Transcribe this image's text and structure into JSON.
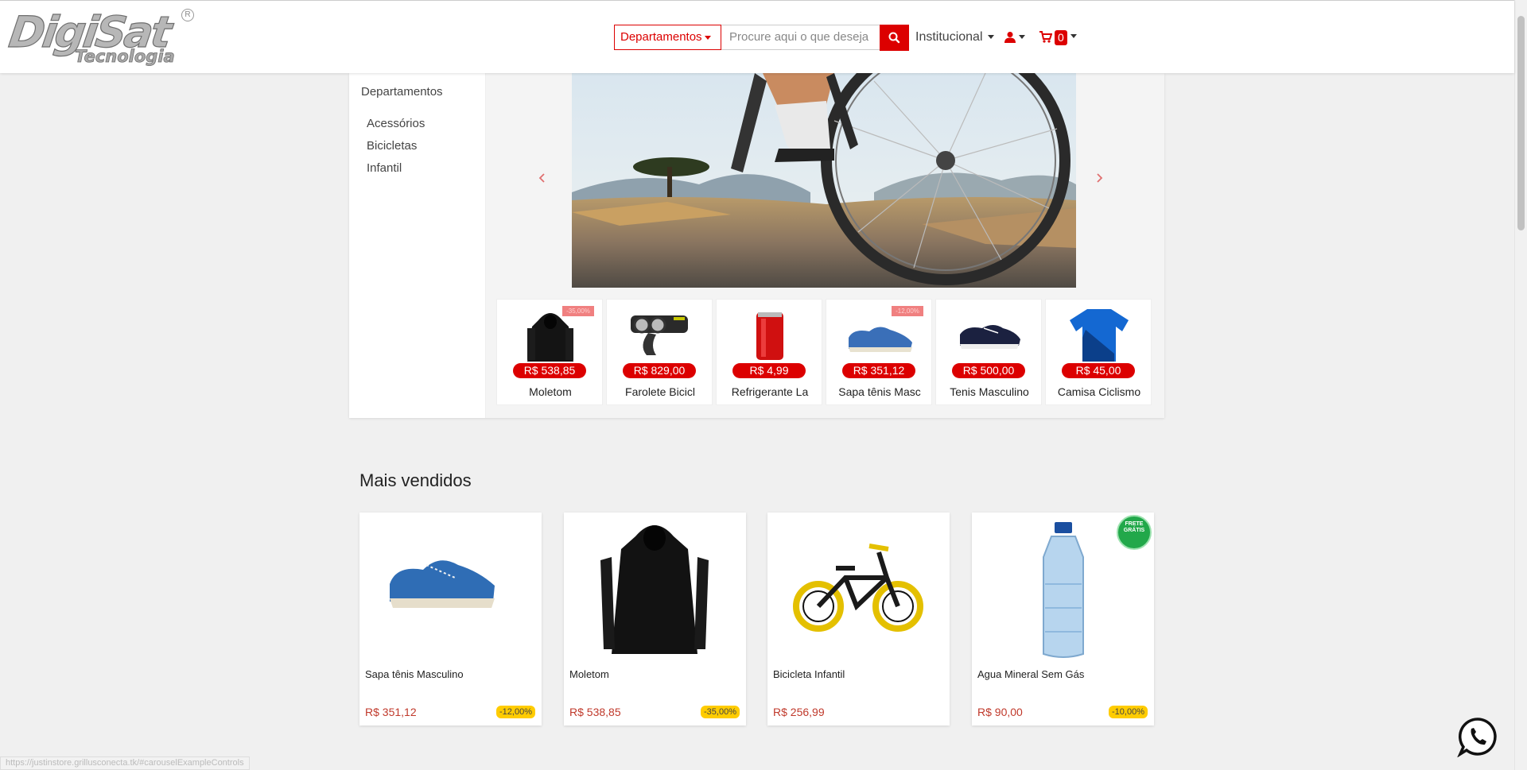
{
  "header": {
    "logo_text": "DigiSat",
    "logo_sub": "Tecnologia",
    "departments_label": "Departamentos",
    "search_placeholder": "Procure aqui o que deseja",
    "institutional_label": "Institucional",
    "cart_count": "0"
  },
  "sidebar": {
    "title": "Departamentos",
    "items": [
      {
        "label": "Acessórios"
      },
      {
        "label": "Bicicletas"
      },
      {
        "label": "Infantil"
      }
    ]
  },
  "carousel_products": [
    {
      "name": "Moletom",
      "price": "R$ 538,85",
      "discount": "-35,00%"
    },
    {
      "name": "Farolete Bicicl",
      "price": "R$ 829,00"
    },
    {
      "name": "Refrigerante La",
      "price": "R$ 4,99"
    },
    {
      "name": "Sapa tênis Masc",
      "price": "R$ 351,12",
      "discount": "-12,00%"
    },
    {
      "name": "Tenis Masculino",
      "price": "R$ 500,00"
    },
    {
      "name": "Camisa Ciclismo",
      "price": "R$ 45,00"
    }
  ],
  "best_sellers": {
    "title": "Mais vendidos",
    "products": [
      {
        "name": "Sapa tênis Masculino",
        "price": "R$ 351,12",
        "discount": "-12,00%"
      },
      {
        "name": "Moletom",
        "price": "R$ 538,85",
        "discount": "-35,00%"
      },
      {
        "name": "Bicicleta Infantil",
        "price": "R$ 256,99"
      },
      {
        "name": "Agua Mineral Sem Gás",
        "price": "R$ 90,00",
        "discount": "-10,00%",
        "badge": "FRETE GRÁTIS"
      }
    ]
  },
  "status_url": "https://justinstore.grillusconecta.tk/#carouselExampleControls",
  "colors": {
    "accent": "#dc0000",
    "discount_badge": "#ffcc00",
    "price": "#c0392b"
  }
}
